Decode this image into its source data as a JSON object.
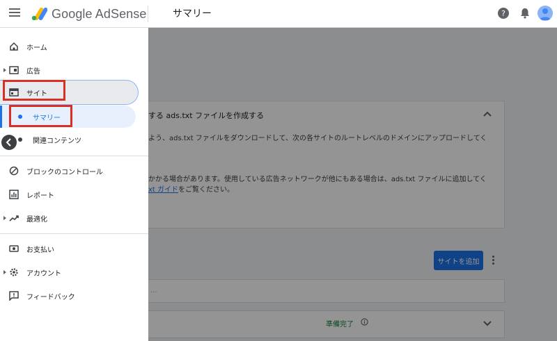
{
  "header": {
    "brand": "Google AdSense",
    "page_title": "サマリー"
  },
  "sidebar": {
    "items": [
      {
        "label": "ホーム",
        "icon": "home-icon"
      },
      {
        "label": "広告",
        "icon": "ad-icon"
      },
      {
        "label": "サイト",
        "icon": "site-icon"
      },
      {
        "label": "サマリー"
      },
      {
        "label": "関連コンテンツ"
      },
      {
        "label": "ブロックのコントロール",
        "icon": "block-icon"
      },
      {
        "label": "レポート",
        "icon": "report-icon"
      },
      {
        "label": "最適化",
        "icon": "trending-up-icon"
      },
      {
        "label": "お支払い",
        "icon": "payment-icon"
      },
      {
        "label": "アカウント",
        "icon": "gear-icon"
      },
      {
        "label": "フィードバック",
        "icon": "feedback-icon"
      }
    ]
  },
  "main": {
    "card_title": "する ads.txt ファイルを作成する",
    "card_line1": "よう、ads.txt ファイルをダウンロードして、次の各サイトのルートレベルのドメインにアップロードしてく",
    "card_line2": "かかる場合があります。使用している広告ネットワークが他にもある場合は、ads.txt ファイルに追加してく",
    "card_line3_link": "xt ガイド",
    "card_line3_rest": "をご覧ください。",
    "add_site_button": "サイトを追加",
    "search_placeholder": "...",
    "status_text": "準備完了"
  },
  "colors": {
    "accent": "#1a73e8",
    "highlight_red": "#d93025",
    "status_green": "#188038"
  }
}
